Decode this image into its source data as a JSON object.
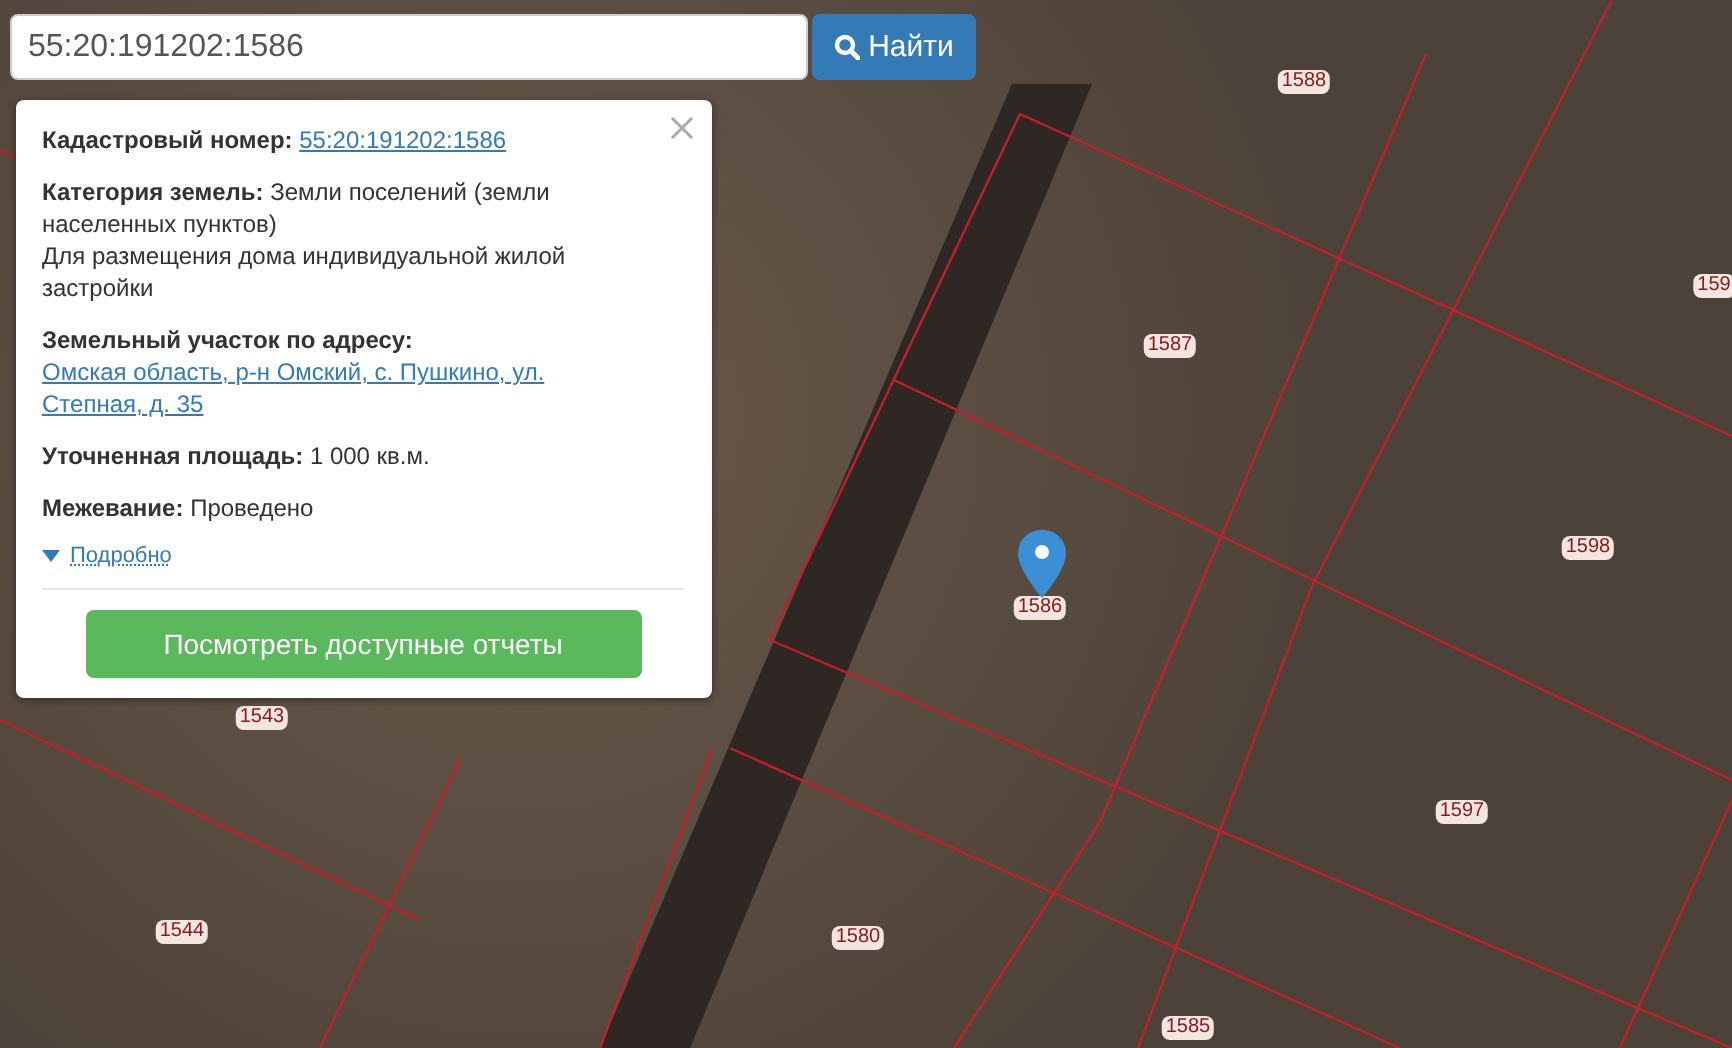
{
  "search": {
    "value": "55:20:191202:1586",
    "button": "Найти"
  },
  "popup": {
    "fields": [
      {
        "label": "Кадастровый номер:",
        "value": "55:20:191202:1586",
        "kind": "link"
      },
      {
        "label": "Категория земель:",
        "value": "Земли поселений (земли населенных пунктов)",
        "note": "Для размещения дома индивидуальной жилой застройки",
        "kind": "text"
      },
      {
        "label": "Земельный участок по адресу:",
        "value": "Омская область, р-н Омский, с. Пушкино, ул. Степная, д. 35",
        "kind": "block_link"
      },
      {
        "label": "Уточненная площадь:",
        "value": "1 000 кв.м.",
        "kind": "text"
      },
      {
        "label": "Межевание:",
        "value": "Проведено",
        "kind": "text"
      }
    ],
    "details_link": "Подробно",
    "action_button": "Посмотреть доступные отчеты"
  },
  "map": {
    "parcel_labels": [
      "1588",
      "1587",
      "159",
      "1598",
      "1586",
      "1597",
      "1543",
      "1544",
      "1580",
      "1585"
    ]
  }
}
